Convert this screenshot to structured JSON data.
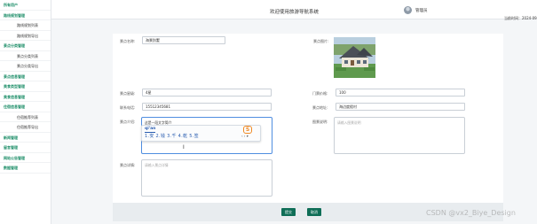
{
  "sidebar": {
    "items": [
      {
        "label": "所有用户",
        "type": "group"
      },
      {
        "label": "路线规划管理",
        "type": "group"
      },
      {
        "label": "路线规划列表",
        "type": "child"
      },
      {
        "label": "路线规划导出",
        "type": "child"
      },
      {
        "label": "景点分类管理",
        "type": "group"
      },
      {
        "label": "景点分类列表",
        "type": "child"
      },
      {
        "label": "景点分类导出",
        "type": "child"
      },
      {
        "label": "景点信息管理",
        "type": "group"
      },
      {
        "label": "美食类型管理",
        "type": "group"
      },
      {
        "label": "美食信息管理",
        "type": "group"
      },
      {
        "label": "住宿信息管理",
        "type": "group"
      },
      {
        "label": "住宿推荐列表",
        "type": "child"
      },
      {
        "label": "住宿推荐导出",
        "type": "child"
      },
      {
        "label": "新闻管理",
        "type": "group"
      },
      {
        "label": "留言管理",
        "type": "group"
      },
      {
        "label": "网站公告管理",
        "type": "group"
      },
      {
        "label": "数据管理",
        "type": "group"
      }
    ]
  },
  "header": {
    "title": "欢迎使用旅游导航系统",
    "user": "管理员",
    "time": "当前时间：2024-09"
  },
  "form": {
    "name_label": "景点名称:",
    "name_value": "海景别墅",
    "image_label": "景点图片:",
    "rating_label": "景点星级:",
    "rating_value": "4星",
    "price_label": "门票价格:",
    "price_value": "100",
    "phone_label": "联系电话:",
    "phone_value": "15512345681",
    "address_label": "景点地址:",
    "address_value": "海边度假村",
    "intro_label": "景点介绍:",
    "intro_value": "这是一段文字简介",
    "notes_label": "图景说明:",
    "notes_placeholder": "请输入图景说明",
    "detail_label": "景点详情:",
    "detail_placeholder": "请输入景点详情"
  },
  "ime": {
    "pinyin": "qi'an",
    "candidates": "1.安  2.钱  3.千  4.乾  5.签",
    "nav": "‹  ›  ▾",
    "logo": "S"
  },
  "buttons": {
    "submit": "提交",
    "cancel": "取消"
  },
  "watermark": "CSDN @vx2_Biye_Design"
}
